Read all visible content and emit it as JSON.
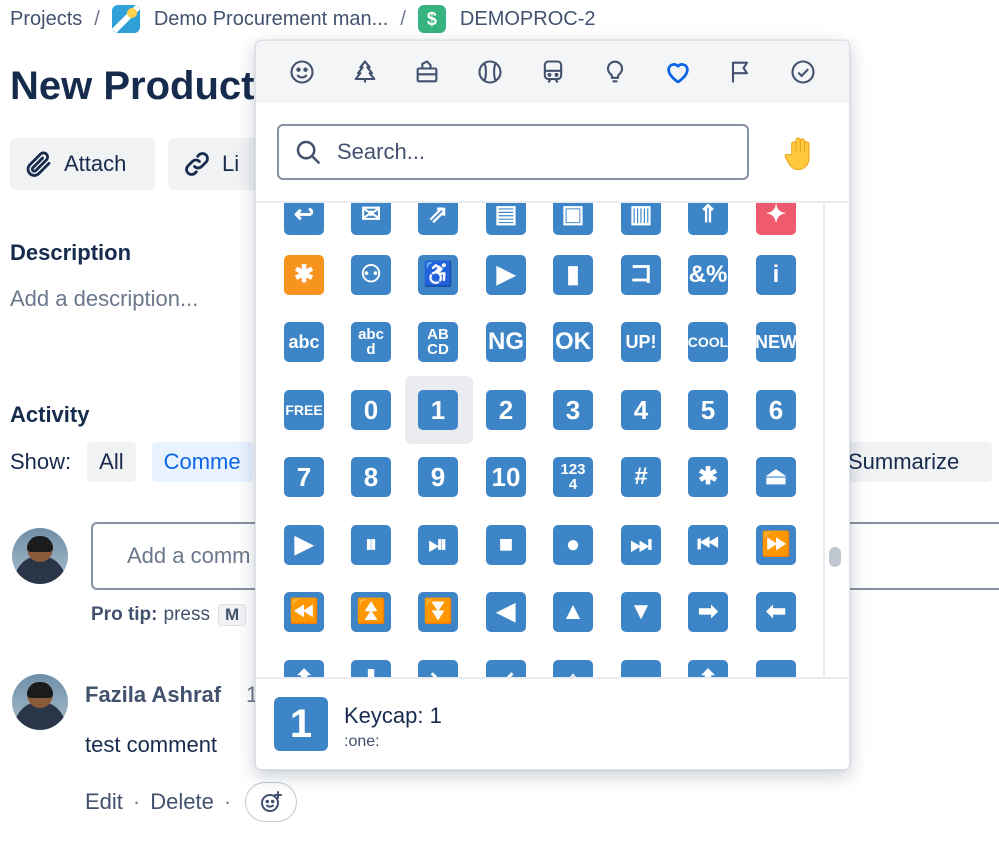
{
  "breadcrumb": {
    "items": [
      "Projects",
      "Demo Procurement man...",
      "DEMOPROC-2"
    ],
    "separator": "/"
  },
  "issue": {
    "title": "New Product E"
  },
  "toolbar": {
    "attach_label": "Attach",
    "link_label": "Li"
  },
  "description": {
    "heading": "Description",
    "placeholder": "Add a description..."
  },
  "activity": {
    "heading": "Activity",
    "show_label": "Show:",
    "filters": [
      "All",
      "Comme"
    ],
    "summarize_label": "Summarize",
    "comment_placeholder": "Add a comm",
    "pro_tip_label": "Pro tip:",
    "pro_tip_text": "press",
    "pro_tip_key": "M"
  },
  "comment": {
    "author": "Fazila Ashraf",
    "time_fragment": "1",
    "body": "test comment",
    "edit_label": "Edit",
    "delete_label": "Delete",
    "separator": "·"
  },
  "emoji_picker": {
    "categories": [
      "smiley-icon",
      "tree-icon",
      "food-icon",
      "ball-icon",
      "train-icon",
      "bulb-icon",
      "heart-icon",
      "flag-icon",
      "check-circle-icon"
    ],
    "active_category": "heart-icon",
    "accent_color": "#0c66e4",
    "emoji_color": "#3d85c6",
    "search_placeholder": "Search...",
    "skin_tone_icon": "raised-hand-icon",
    "rows": [
      [
        {
          "t": "↩"
        },
        {
          "t": "✉"
        },
        {
          "t": "⇗"
        },
        {
          "t": "▤"
        },
        {
          "t": "▣"
        },
        {
          "t": "▥"
        },
        {
          "t": "⇑"
        },
        {
          "t": "✦"
        }
      ],
      [
        {
          "t": "✱"
        },
        {
          "t": "⚇"
        },
        {
          "t": "♿"
        },
        {
          "t": "▶"
        },
        {
          "t": "▮"
        },
        {
          "t": "コ"
        },
        {
          "t": "&%"
        },
        {
          "t": "i"
        }
      ],
      [
        {
          "t": "abc"
        },
        {
          "t": "abcd"
        },
        {
          "t": "ABCD"
        },
        {
          "t": "NG"
        },
        {
          "t": "OK"
        },
        {
          "t": "UP!"
        },
        {
          "t": "COOL"
        },
        {
          "t": "NEW"
        }
      ],
      [
        {
          "t": "FREE"
        },
        {
          "t": "0"
        },
        {
          "t": "1"
        },
        {
          "t": "2"
        },
        {
          "t": "3"
        },
        {
          "t": "4"
        },
        {
          "t": "5"
        },
        {
          "t": "6"
        }
      ],
      [
        {
          "t": "7"
        },
        {
          "t": "8"
        },
        {
          "t": "9"
        },
        {
          "t": "10"
        },
        {
          "t": "1234"
        },
        {
          "t": "#"
        },
        {
          "t": "✱"
        },
        {
          "t": "⏏"
        }
      ],
      [
        {
          "t": "▶"
        },
        {
          "t": "⏸"
        },
        {
          "t": "⏯"
        },
        {
          "t": "■"
        },
        {
          "t": "●"
        },
        {
          "t": "⏭"
        },
        {
          "t": "⏮"
        },
        {
          "t": "⏩"
        }
      ],
      [
        {
          "t": "⏪"
        },
        {
          "t": "⏫"
        },
        {
          "t": "⏬"
        },
        {
          "t": "◀"
        },
        {
          "t": "▲"
        },
        {
          "t": "▼"
        },
        {
          "t": "➡"
        },
        {
          "t": "⬅"
        }
      ],
      [
        {
          "t": "⬆"
        },
        {
          "t": "⬇"
        },
        {
          "t": "↘"
        },
        {
          "t": "↙"
        },
        {
          "t": "↕"
        },
        {
          "t": "↔"
        },
        {
          "t": "⬆"
        },
        {
          "t": "↔"
        }
      ]
    ],
    "preview": {
      "glyph": "1",
      "name": "Keycap: 1",
      "shortcode": ":one:"
    }
  }
}
